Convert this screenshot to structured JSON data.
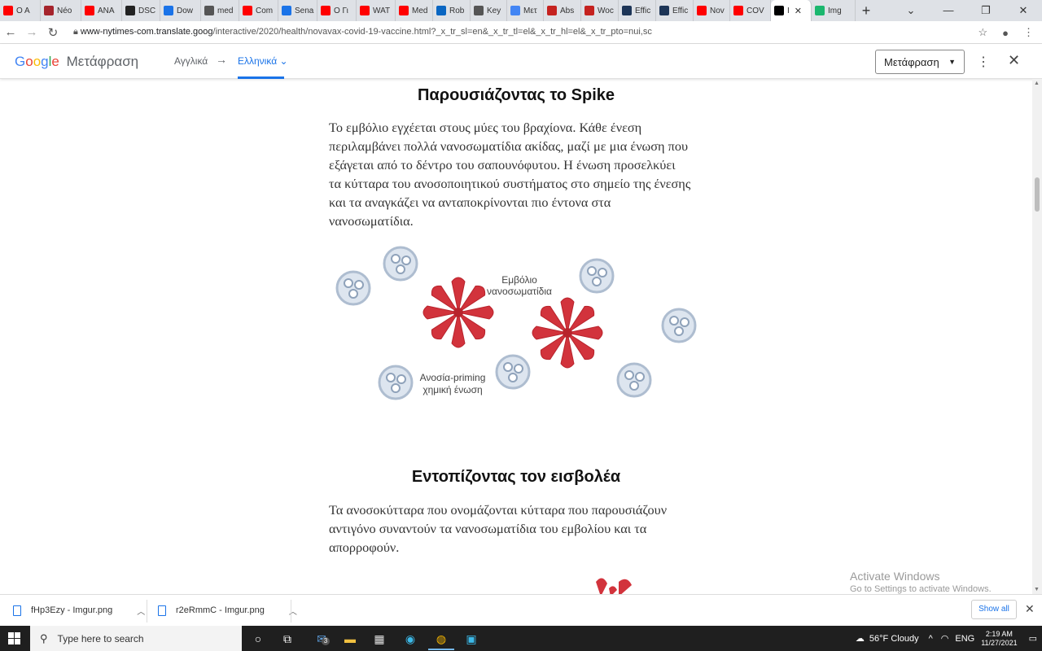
{
  "browser": {
    "tabs": [
      {
        "label": "O A",
        "favicon": "youtube-icon",
        "color": "#ff0000"
      },
      {
        "label": "Néo",
        "favicon": "site-icon",
        "color": "#a5242c"
      },
      {
        "label": "ANA",
        "favicon": "youtube-icon",
        "color": "#ff0000"
      },
      {
        "label": "DSC",
        "favicon": "s-icon",
        "color": "#222222"
      },
      {
        "label": "Dow",
        "favicon": "download-icon",
        "color": "#1a73e8"
      },
      {
        "label": "med",
        "favicon": "globe-icon",
        "color": "#555555"
      },
      {
        "label": "Com",
        "favicon": "youtube-icon",
        "color": "#ff0000"
      },
      {
        "label": "Sena",
        "favicon": "play-icon",
        "color": "#1a73e8"
      },
      {
        "label": "O Γι",
        "favicon": "youtube-icon",
        "color": "#ff0000"
      },
      {
        "label": "WAT",
        "favicon": "youtube-icon",
        "color": "#ff0000"
      },
      {
        "label": "Med",
        "favicon": "youtube-icon",
        "color": "#ff0000"
      },
      {
        "label": "Rob",
        "favicon": "linkedin-icon",
        "color": "#0a66c2"
      },
      {
        "label": "Key",
        "favicon": "globe-icon",
        "color": "#555555"
      },
      {
        "label": "Μετ",
        "favicon": "translate-icon",
        "color": "#4285f4"
      },
      {
        "label": "Abs",
        "favicon": "shield-icon",
        "color": "#c5221f"
      },
      {
        "label": "Woc",
        "favicon": "w-icon",
        "color": "#c5221f"
      },
      {
        "label": "Effic",
        "favicon": "mr-icon",
        "color": "#1d3557"
      },
      {
        "label": "Effic",
        "favicon": "mr-icon",
        "color": "#1d3557"
      },
      {
        "label": "Nov",
        "favicon": "youtube-icon",
        "color": "#ff0000"
      },
      {
        "label": "COV",
        "favicon": "youtube-icon",
        "color": "#ff0000"
      },
      {
        "label": "Ι",
        "favicon": "nyt-icon",
        "color": "#000000",
        "active": true
      },
      {
        "label": "Img",
        "favicon": "imgur-icon",
        "color": "#1bb76e"
      }
    ],
    "url_host": "www-nytimes-com.translate.goog",
    "url_path": "/interactive/2020/health/novavax-covid-19-vaccine.html?_x_tr_sl=en&_x_tr_tl=el&_x_tr_hl=el&_x_tr_pto=nui,sc"
  },
  "translate_bar": {
    "logo": [
      "G",
      "o",
      "o",
      "g",
      "l",
      "e"
    ],
    "product": "Μετάφραση",
    "source_lang": "Αγγλικά",
    "arrow": "→",
    "target_lang": "Ελληνικά",
    "translate_select": "Μετάφραση"
  },
  "article": {
    "section1_title": "Παρουσιάζοντας το Spike",
    "section1_lines": [
      "Το εμβόλιο εγχέεται στους μύες του βραχίονα. Κάθε ένεση",
      "περιλαμβάνει πολλά νανοσωματίδια ακίδας, μαζί με μια ένωση που",
      "εξάγεται από το δέντρο του σαπουνόφυτου. Η ένωση προσελκύει",
      "τα κύτταρα του ανοσοποιητικού συστήματος στο σημείο της ένεσης",
      "και τα αναγκάζει να ανταποκρίνονται πιο έντονα στα",
      "νανοσωματίδια."
    ],
    "figure_labels": {
      "vaccine_line1": "Εμβόλιο",
      "vaccine_line2": "νανοσωματίδια",
      "adjuvant_line1": "Ανοσία-priming",
      "adjuvant_line2": "χημική ένωση"
    },
    "section2_title": "Εντοπίζοντας τον εισβολέα",
    "section2_lines": [
      "Τα ανοσοκύτταρα που ονομάζονται κύτταρα που παρουσιάζουν",
      "αντιγόνο συναντούν τα νανοσωματίδια του εμβολίου και τα",
      "απορροφούν."
    ]
  },
  "watermark": {
    "line1": "Activate Windows",
    "line2": "Go to Settings to activate Windows."
  },
  "downloads": {
    "items": [
      "fHp3Ezy - Imgur.png",
      "r2eRmmC - Imgur.png"
    ],
    "show_all": "Show all"
  },
  "taskbar": {
    "search_placeholder": "Type here to search",
    "mail_badge": "3",
    "weather": "56°F  Cloudy",
    "lang": "ENG",
    "time": "2:19 AM",
    "date": "11/27/2021"
  },
  "colors": {
    "spike_red": "#d2333c",
    "adjuvant_blue": "#b9c7d8",
    "google_blue": "#1a73e8"
  }
}
